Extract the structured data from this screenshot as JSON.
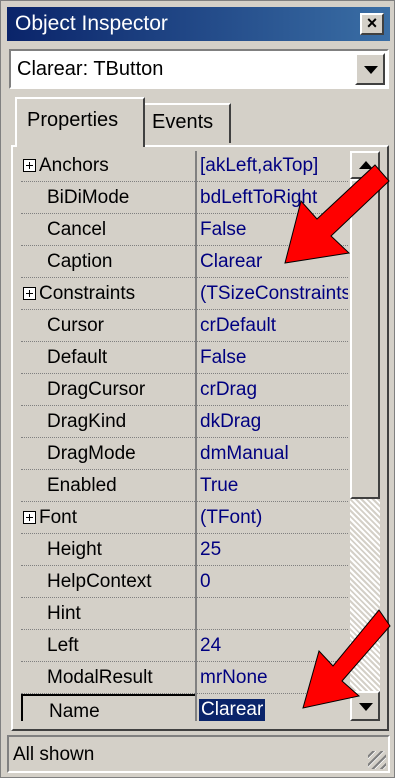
{
  "window": {
    "title": "Object Inspector",
    "close_glyph": "×"
  },
  "component_selector": {
    "value": "Clarear: TButton"
  },
  "tabs": [
    {
      "label": "Properties",
      "active": true
    },
    {
      "label": "Events",
      "active": false
    }
  ],
  "properties": [
    {
      "name": "Anchors",
      "value": "[akLeft,akTop]",
      "expandable": true
    },
    {
      "name": "BiDiMode",
      "value": "bdLeftToRight",
      "expandable": false
    },
    {
      "name": "Cancel",
      "value": "False",
      "expandable": false
    },
    {
      "name": "Caption",
      "value": "Clarear",
      "expandable": false
    },
    {
      "name": "Constraints",
      "value": "(TSizeConstraints)",
      "expandable": true
    },
    {
      "name": "Cursor",
      "value": "crDefault",
      "expandable": false
    },
    {
      "name": "Default",
      "value": "False",
      "expandable": false
    },
    {
      "name": "DragCursor",
      "value": "crDrag",
      "expandable": false
    },
    {
      "name": "DragKind",
      "value": "dkDrag",
      "expandable": false
    },
    {
      "name": "DragMode",
      "value": "dmManual",
      "expandable": false
    },
    {
      "name": "Enabled",
      "value": "True",
      "expandable": false
    },
    {
      "name": "Font",
      "value": "(TFont)",
      "expandable": true
    },
    {
      "name": "Height",
      "value": "25",
      "expandable": false
    },
    {
      "name": "HelpContext",
      "value": "0",
      "expandable": false
    },
    {
      "name": "Hint",
      "value": "",
      "expandable": false
    },
    {
      "name": "Left",
      "value": "24",
      "expandable": false
    },
    {
      "name": "ModalResult",
      "value": "mrNone",
      "expandable": false
    },
    {
      "name": "Name",
      "value": "Clarear",
      "expandable": false,
      "selected": true
    }
  ],
  "status_bar": {
    "text": "All shown"
  },
  "colors": {
    "title_start": "#0a246a",
    "title_end": "#3a6ea5",
    "value_text": "#000080",
    "arrow": "#ff0000"
  },
  "icons": {
    "close": "close-icon",
    "dropdown": "chevron-down-icon",
    "expand": "plus-box-icon",
    "arrow": "red-arrow-icon"
  }
}
